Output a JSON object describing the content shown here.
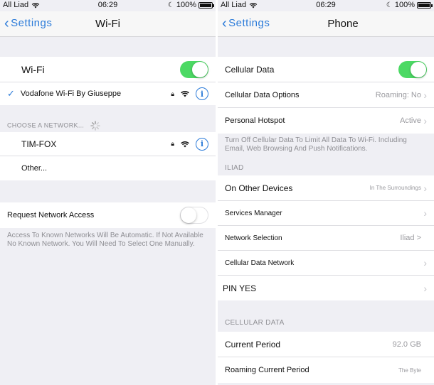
{
  "status_left": {
    "carrier": "All Liad",
    "time": "06:29",
    "battery": "100%"
  },
  "status_right": {
    "carrier": "All Liad",
    "time": "06:29",
    "battery": "100%"
  },
  "wifi_screen": {
    "back_label": "Settings",
    "title": "Wi-Fi",
    "wifi_label": "Wi-Fi",
    "wifi_enabled": true,
    "connected_network": "Vodafone Wi-Fi By Giuseppe",
    "choose_header": "CHOOSE A NETWORK...",
    "networks": [
      {
        "name": "TIM-FOX"
      },
      {
        "name": "Other..."
      }
    ],
    "request_access_label": "Request Network Access",
    "request_access_enabled": false,
    "request_footnote": "Access To Known Networks Will Be Automatic. If Not Available No Known Network. You Will Need To Select One Manually."
  },
  "phone_screen": {
    "back_label": "Settings",
    "title": "Phone",
    "cellular_data_label": "Cellular Data",
    "cellular_data_enabled": true,
    "cellular_options_label": "Cellular Data Options",
    "cellular_options_value": "Roaming: No",
    "hotspot_label": "Personal Hotspot",
    "hotspot_value": "Active",
    "footnote": "Turn Off Cellular Data To Limit All Data To Wi-Fi. Including Email, Web Browsing And Push Notifications.",
    "iliad_header": "ILIAD",
    "on_other_devices_label": "On Other Devices",
    "on_other_devices_value": "In The Surroundings",
    "services_manager_label": "Services Manager",
    "network_selection_label": "Network Selection",
    "network_selection_value": "Iliad >",
    "cellular_data_network_label": "Cellular Data Network",
    "pin_label": "PIN YES",
    "cellular_data_header": "CELLULAR DATA",
    "current_period_label": "Current Period",
    "current_period_value": "92.0 GB",
    "roaming_current_period_label": "Roaming Current Period",
    "roaming_current_period_value": "The Byte"
  },
  "colors": {
    "accent": "#2b7bd9",
    "toggle_on": "#4cd964",
    "background": "#efeff4"
  },
  "icons": {
    "wifi": "wifi-icon",
    "lock": "lock-icon",
    "info": "info-icon",
    "check": "checkmark-icon",
    "chevron": "chevron-right-icon",
    "back": "chevron-left-icon",
    "moon": "moon-icon",
    "battery": "battery-icon",
    "spinner": "spinner-icon"
  }
}
